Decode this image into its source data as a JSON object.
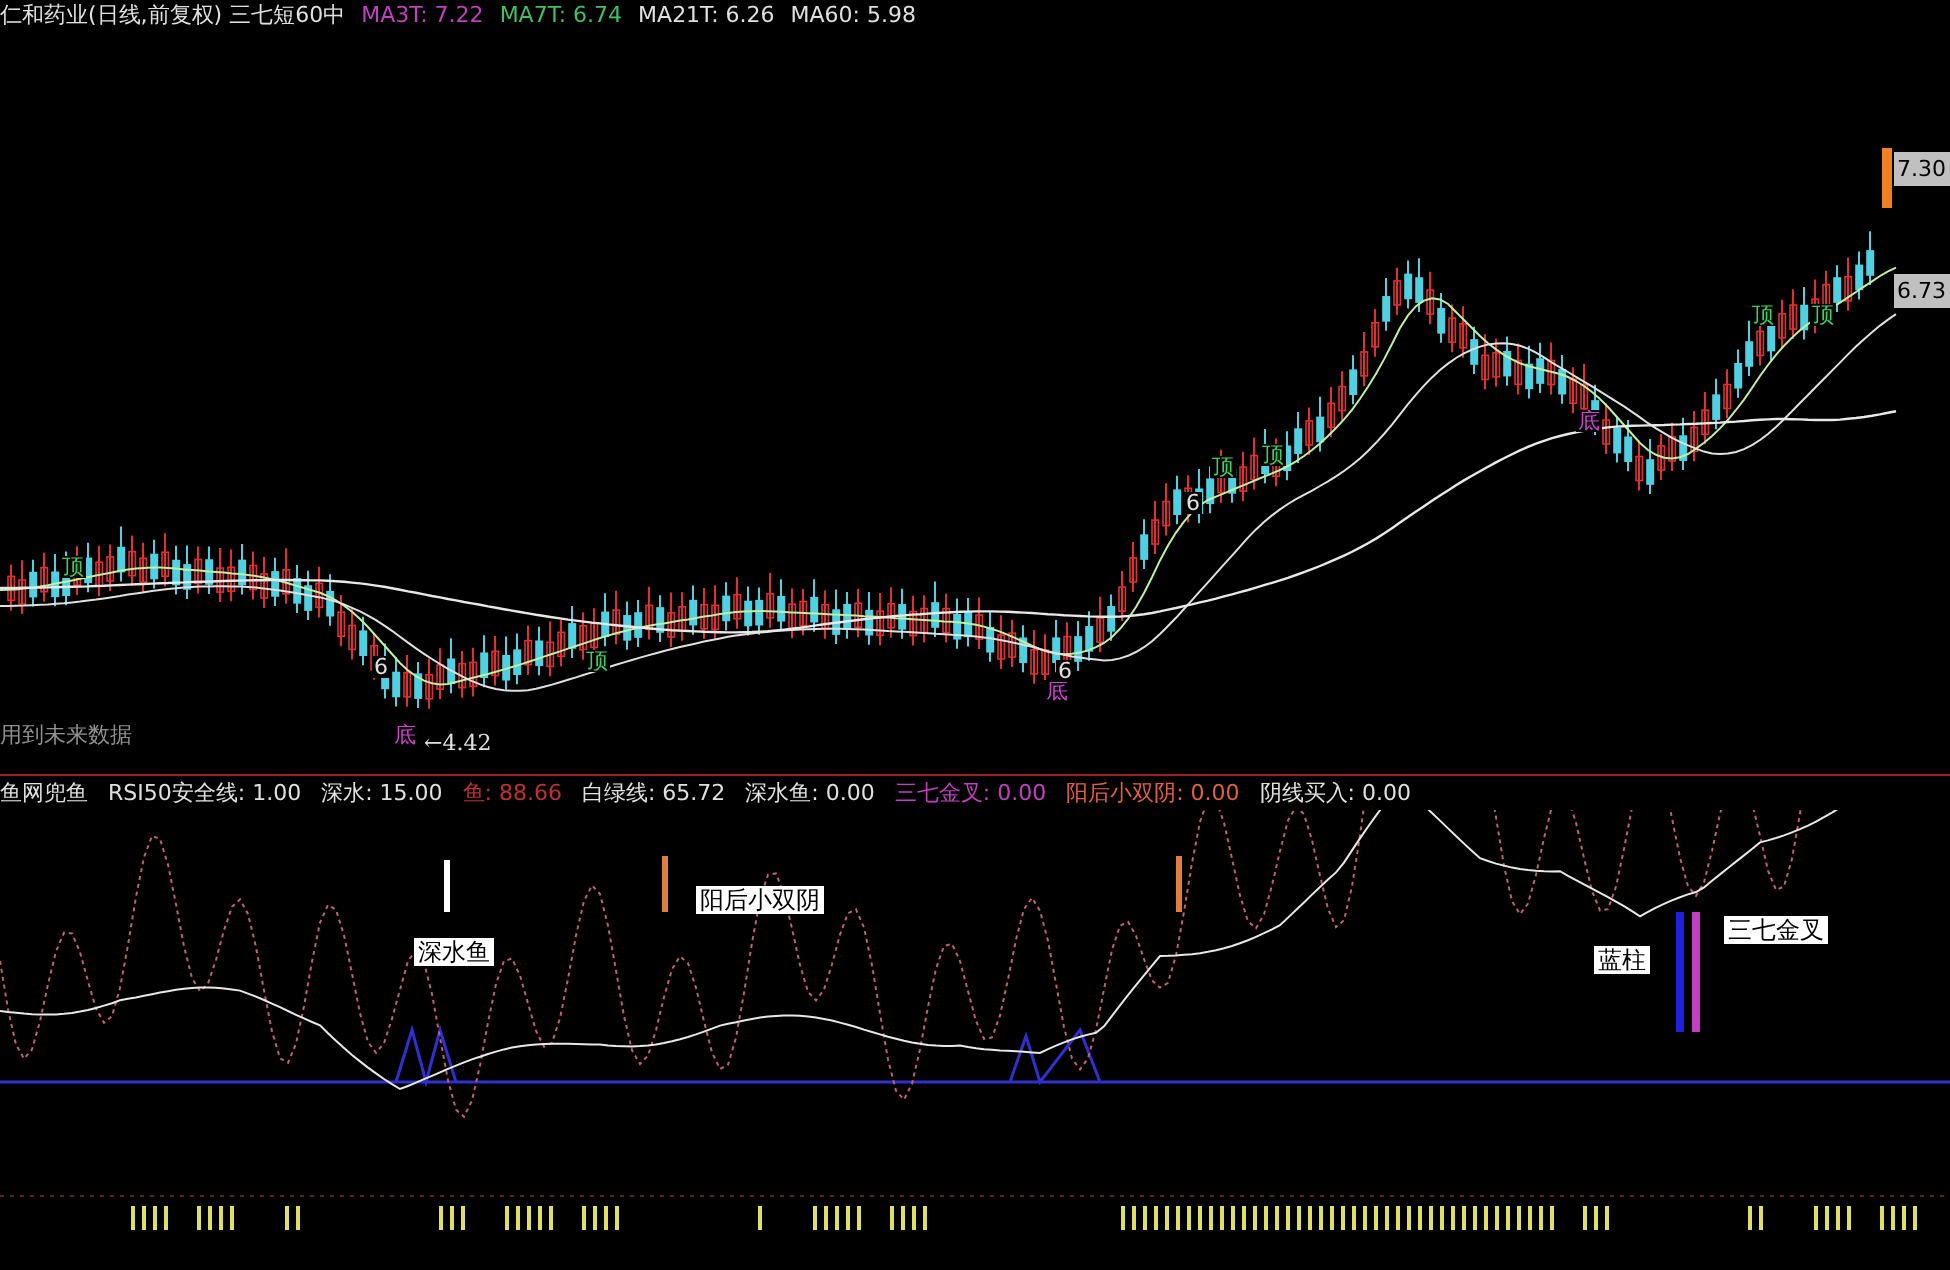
{
  "price_panel": {
    "title": "仁和药业(日线,前复权) 三七短60中",
    "indicators": [
      {
        "label": "MA3T: 7.22",
        "color": "#c040c0"
      },
      {
        "label": "MA7T: 6.74",
        "color": "#40c060"
      },
      {
        "label": "MA21T: 6.26",
        "color": "#e0e0e0"
      },
      {
        "label": "MA60: 5.98",
        "color": "#e0e0e0"
      }
    ],
    "price_tags": [
      "7.30",
      "6.73"
    ],
    "markers": [
      {
        "text": "顶",
        "kind": "top"
      },
      {
        "text": "顶",
        "kind": "top"
      },
      {
        "text": "顶",
        "kind": "top"
      },
      {
        "text": "顶",
        "kind": "top"
      },
      {
        "text": "顶",
        "kind": "top"
      },
      {
        "text": "顶",
        "kind": "top"
      },
      {
        "text": "底",
        "kind": "bottom"
      },
      {
        "text": "底",
        "kind": "bottom"
      },
      {
        "text": "底",
        "kind": "bottom"
      },
      {
        "text": "6",
        "kind": "count"
      },
      {
        "text": "6",
        "kind": "count"
      },
      {
        "text": "6",
        "kind": "count"
      }
    ],
    "low_label": "←4.42",
    "note": "用到未来数据"
  },
  "indicator_panel": {
    "items": [
      {
        "label": "鱼网兜鱼",
        "color": "#e0e0e0"
      },
      {
        "label": "RSI50安全线: 1.00",
        "color": "#e0e0e0"
      },
      {
        "label": "深水: 15.00",
        "color": "#e0e0e0"
      },
      {
        "label": "鱼: 88.66",
        "color": "#c03030"
      },
      {
        "label": "白绿线: 65.72",
        "color": "#e0e0e0"
      },
      {
        "label": "深水鱼: 0.00",
        "color": "#e0e0e0"
      },
      {
        "label": "三七金叉: 0.00",
        "color": "#c040c0"
      },
      {
        "label": "阳后小双阴: 0.00",
        "color": "#e06040"
      },
      {
        "label": "阴线买入: 0.00",
        "color": "#e0e0e0"
      }
    ],
    "signal_labels": [
      "深水鱼",
      "阳后小双阴",
      "蓝柱",
      "三七金叉"
    ]
  }
}
